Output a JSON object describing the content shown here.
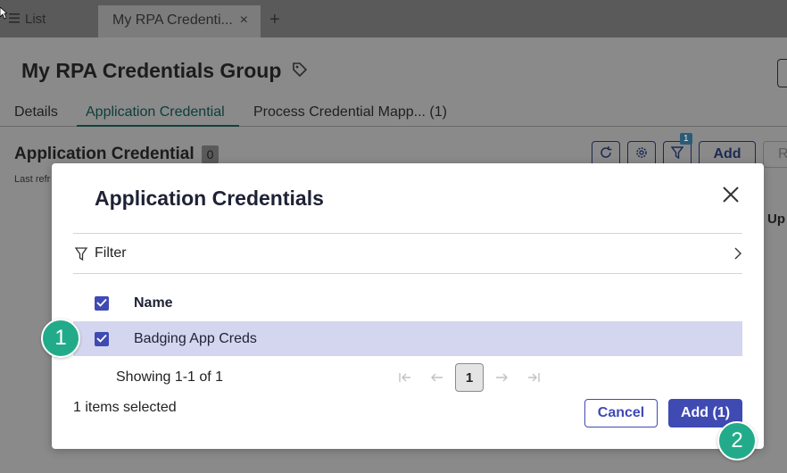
{
  "tabbar": {
    "list_label": "List",
    "active_tab_label": "My RPA Credenti...",
    "active_tab_close": "×",
    "new_tab": "+"
  },
  "page": {
    "title": "My RPA Credentials Group",
    "subtabs": [
      {
        "label": "Details"
      },
      {
        "label": "Application Credential"
      },
      {
        "label": "Process Credential Mapp... (1)"
      }
    ],
    "active_subtab": "Application Credential"
  },
  "section": {
    "title": "Application Credential",
    "count": "0",
    "last_refreshed": "Last refr",
    "filter_badge": "1",
    "add_label": "Add",
    "r_label": "R",
    "partial_column": "Up"
  },
  "modal": {
    "title": "Application Credentials",
    "filter_label": "Filter",
    "column_name": "Name",
    "rows": [
      {
        "name": "Badging App Creds",
        "selected": true
      }
    ],
    "showing": "Showing 1-1 of 1",
    "current_page": "1",
    "items_selected": "1 items selected",
    "cancel_label": "Cancel",
    "add_label": "Add (1)"
  },
  "step_markers": [
    "1",
    "2"
  ],
  "colors": {
    "accent": "#3f4ab3",
    "selected_row": "#d4d6ef",
    "step_marker": "#22ab8a",
    "overlay": "#8a8a8a"
  },
  "icons": {
    "list": "list-icon",
    "tag": "tag-icon",
    "refresh": "refresh-icon",
    "settings": "gear-icon",
    "filter": "filter-icon",
    "close": "close-icon",
    "chevron": "chevron-right-icon",
    "first_page": "first-page-icon",
    "prev_page": "prev-page-icon",
    "next_page": "next-page-icon",
    "last_page": "last-page-icon"
  }
}
